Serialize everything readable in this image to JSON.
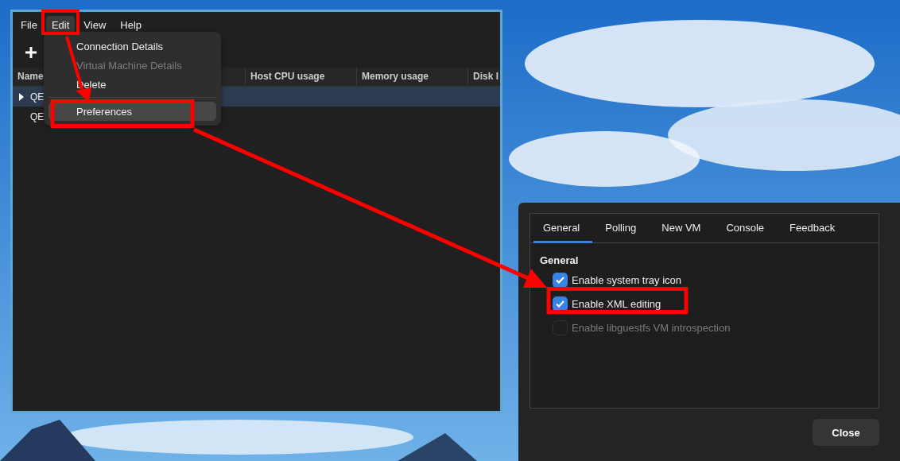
{
  "main_window": {
    "menu_bar": [
      {
        "label": "File",
        "selected": false
      },
      {
        "label": "Edit",
        "selected": true
      },
      {
        "label": "View",
        "selected": false
      },
      {
        "label": "Help",
        "selected": false
      }
    ],
    "table": {
      "columns": [
        "Name",
        "Host CPU usage",
        "Memory usage",
        "Disk I"
      ],
      "rows": [
        {
          "name": "QE",
          "selected": true,
          "expandable": true
        },
        {
          "name": "QE",
          "selected": false,
          "expandable": false
        }
      ]
    }
  },
  "edit_menu": {
    "items": [
      {
        "kind": "item",
        "label": "Connection Details",
        "disabled": false,
        "selected": false
      },
      {
        "kind": "item",
        "label": "Virtual Machine Details",
        "disabled": true,
        "selected": false
      },
      {
        "kind": "item",
        "label": "Delete",
        "disabled": false,
        "selected": false
      },
      {
        "kind": "separator"
      },
      {
        "kind": "item",
        "label": "Preferences",
        "disabled": false,
        "selected": true
      }
    ]
  },
  "preferences_dialog": {
    "tabs": [
      {
        "label": "General",
        "selected": true
      },
      {
        "label": "Polling",
        "selected": false
      },
      {
        "label": "New VM",
        "selected": false
      },
      {
        "label": "Console",
        "selected": false
      },
      {
        "label": "Feedback",
        "selected": false
      }
    ],
    "section_title": "General",
    "options": [
      {
        "label": "Enable system tray icon",
        "checked": true,
        "disabled": false
      },
      {
        "label": "Enable XML editing",
        "checked": true,
        "disabled": false
      },
      {
        "label": "Enable libguestfs VM introspection",
        "checked": false,
        "disabled": true
      }
    ],
    "buttons": [
      "Close"
    ]
  }
}
